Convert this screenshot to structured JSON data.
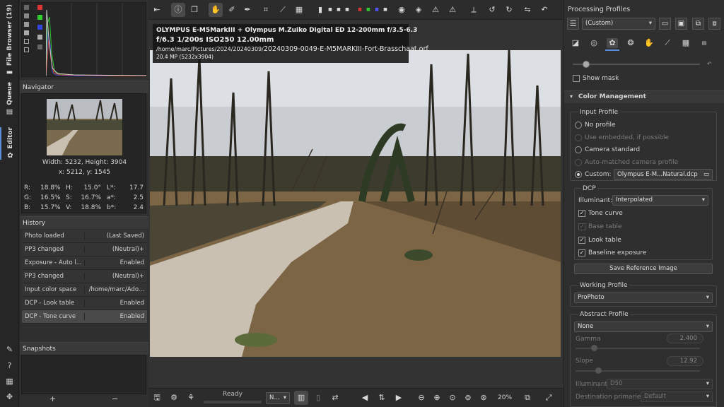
{
  "vertical_tabs": {
    "file_browser": "File Browser (19)",
    "queue": "Queue",
    "editor": "Editor"
  },
  "histogram": {},
  "navigator": {
    "title": "Navigator",
    "size": "Width: 5232, Height: 3904",
    "coords": "x: 5212, y: 1545",
    "r_label": "R:",
    "r_val": "18.8%",
    "g_label": "G:",
    "g_val": "16.5%",
    "b_label": "B:",
    "b_val": "15.7%",
    "h_label": "H:",
    "h_val": "15.0°",
    "s_label": "S:",
    "s_val": "16.7%",
    "v_label": "V:",
    "v_val": "18.8%",
    "l_label": "L*:",
    "l_val": "17.7",
    "a_label": "a*:",
    "a_val": "2.5",
    "bb_label": "b*:",
    "bb_val": "2.4"
  },
  "history": {
    "title": "History",
    "rows": [
      {
        "a": "Photo loaded",
        "b": "(Last Saved)"
      },
      {
        "a": "PP3 changed",
        "b": "(Neutral)+"
      },
      {
        "a": "Exposure - Auto l...",
        "b": "Enabled"
      },
      {
        "a": "PP3 changed",
        "b": "(Neutral)+"
      },
      {
        "a": "Input color space",
        "b": "/home/marc/Ado..."
      },
      {
        "a": "DCP - Look table",
        "b": "Enabled"
      },
      {
        "a": "DCP - Tone curve",
        "b": "Enabled"
      }
    ]
  },
  "snapshots": {
    "title": "Snapshots",
    "add": "+",
    "remove": "−"
  },
  "exif": {
    "line1": "OLYMPUS E-M5MarkIII + Olympus M.Zuiko Digital ED 12-200mm f/3.5-6.3",
    "line2": "f/6.3  1/200s  ISO250  12.00mm",
    "path_dir": "/home/marc/Pictures/2024/20240309/",
    "path_file": "20240309-0049-E-M5MARKIII-Fort-Brasschaat.orf",
    "line4": "20.4 MP (5232x3904)"
  },
  "statusbar": {
    "ready": "Ready",
    "n_combo": "N...",
    "zoom": "20%"
  },
  "right": {
    "title": "Processing Profiles",
    "profile_combo": "(Custom)",
    "show_mask": "Show mask",
    "color_mgmt": "Color Management",
    "input_profile": "Input Profile",
    "no_profile": "No profile",
    "use_embedded": "Use embedded, if possible",
    "camera_standard": "Camera standard",
    "auto_matched": "Auto-matched camera profile",
    "custom_label": "Custom:",
    "custom_file": "Olympus E-M...Natural.dcp",
    "dcp": "DCP",
    "illuminant_label": "Illuminant:",
    "illuminant_val": "Interpolated",
    "tone_curve": "Tone curve",
    "base_table": "Base table",
    "look_table": "Look table",
    "baseline_exposure": "Baseline exposure",
    "save_ref": "Save Reference Image",
    "working_profile": "Working Profile",
    "working_val": "ProPhoto",
    "abstract_profile": "Abstract Profile",
    "abstract_val": "None",
    "gamma_label": "Gamma",
    "gamma_val": "2.400",
    "slope_label": "Slope",
    "slope_val": "12.92",
    "illum2_label": "Illuminant:",
    "illum2_val": "D50",
    "dest_label": "Destination primaries:",
    "dest_val": "Default"
  },
  "colors": {
    "accent": "#5a8fd8",
    "panel": "#2f2f2f",
    "toolbar": "#2c2c2c"
  }
}
